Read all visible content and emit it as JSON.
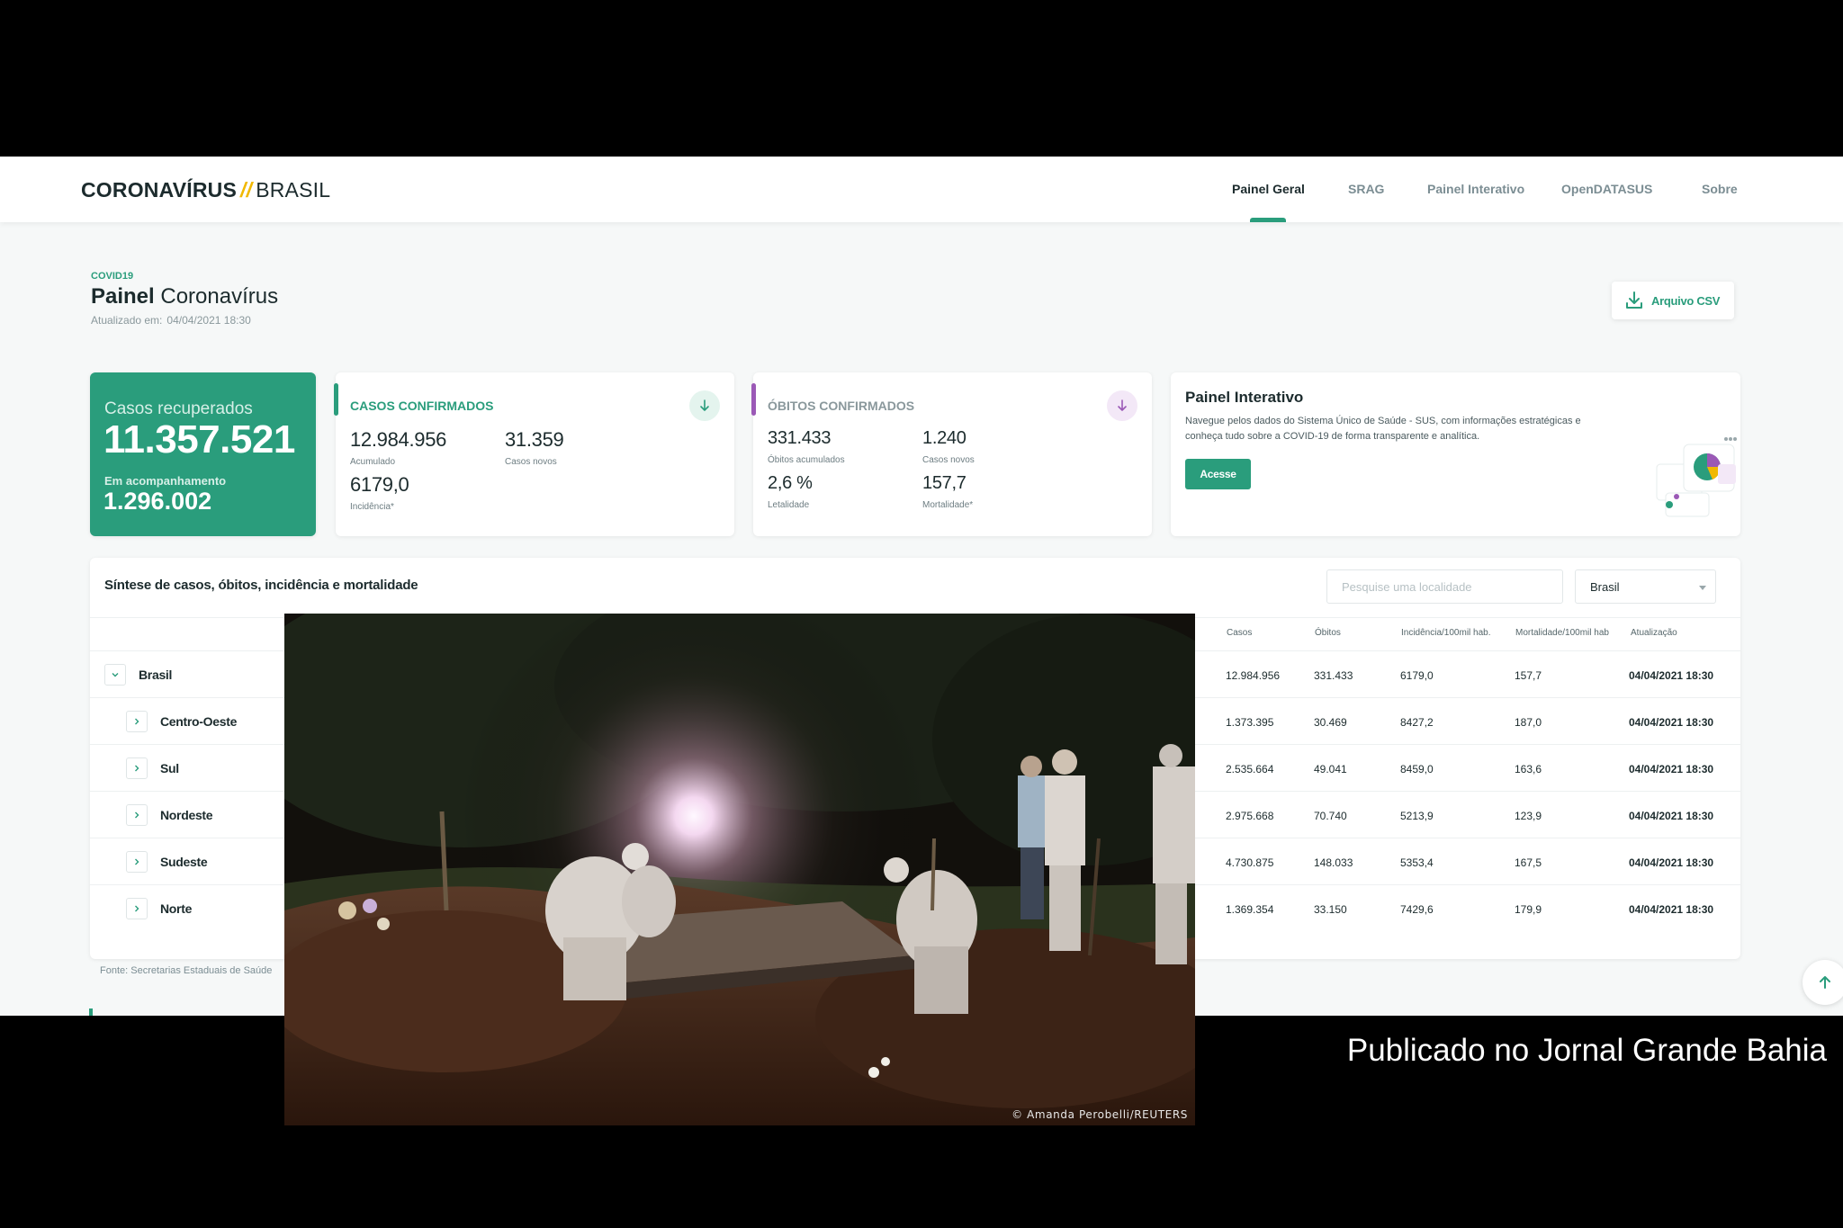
{
  "header": {
    "logo_bold": "CORONAVÍRUS",
    "logo_sep": "//",
    "logo_light": "BRASIL",
    "nav": [
      "Painel Geral",
      "SRAG",
      "Painel Interativo",
      "OpenDATASUS",
      "Sobre"
    ],
    "active_nav": "Painel Geral"
  },
  "page": {
    "eyebrow": "COVID19",
    "title_bold": "Painel",
    "title_light": "Coronavírus",
    "updated_label": "Atualizado em:",
    "updated_value": "04/04/2021 18:30",
    "csv_button": "Arquivo CSV"
  },
  "recovered": {
    "label": "Casos recuperados",
    "value": "11.357.521",
    "monitoring_label": "Em acompanhamento",
    "monitoring_value": "1.296.002"
  },
  "confirmed": {
    "title": "CASOS CONFIRMADOS",
    "accum_value": "12.984.956",
    "accum_label": "Acumulado",
    "new_value": "31.359",
    "new_label": "Casos novos",
    "incid_value": "6179,0",
    "incid_label": "Incidência*"
  },
  "deaths": {
    "title": "ÓBITOS CONFIRMADOS",
    "accum_value": "331.433",
    "accum_label": "Óbitos acumulados",
    "new_value": "1.240",
    "new_label": "Casos novos",
    "lethality_value": "2,6 %",
    "lethality_label": "Letalidade",
    "mortality_value": "157,7",
    "mortality_label": "Mortalidade*"
  },
  "interactive": {
    "title": "Painel Interativo",
    "description": "Navegue pelos dados do Sistema Único de Saúde - SUS, com informações estratégicas e conheça tudo sobre a COVID-19 de forma transparente e analítica.",
    "button": "Acesse"
  },
  "synthesis": {
    "title": "Síntese de casos, óbitos, incidência e mortalidade",
    "search_placeholder": "Pesquise uma localidade",
    "select_value": "Brasil",
    "columns": [
      "Casos",
      "Óbitos",
      "Incidência/100mil hab.",
      "Mortalidade/100mil hab",
      "Atualização"
    ],
    "rows": [
      {
        "name": "Brasil",
        "cases": "12.984.956",
        "deaths": "331.433",
        "incidence": "6179,0",
        "mortality": "157,7",
        "updated": "04/04/2021 18:30"
      },
      {
        "name": "Centro-Oeste",
        "cases": "1.373.395",
        "deaths": "30.469",
        "incidence": "8427,2",
        "mortality": "187,0",
        "updated": "04/04/2021 18:30"
      },
      {
        "name": "Sul",
        "cases": "2.535.664",
        "deaths": "49.041",
        "incidence": "8459,0",
        "mortality": "163,6",
        "updated": "04/04/2021 18:30"
      },
      {
        "name": "Nordeste",
        "cases": "2.975.668",
        "deaths": "70.740",
        "incidence": "5213,9",
        "mortality": "123,9",
        "updated": "04/04/2021 18:30"
      },
      {
        "name": "Sudeste",
        "cases": "4.730.875",
        "deaths": "148.033",
        "incidence": "5353,4",
        "mortality": "167,5",
        "updated": "04/04/2021 18:30"
      },
      {
        "name": "Norte",
        "cases": "1.369.354",
        "deaths": "33.150",
        "incidence": "7429,6",
        "mortality": "179,9",
        "updated": "04/04/2021 18:30"
      }
    ],
    "source": "Fonte: Secretarias Estaduais de Saúde"
  },
  "photo": {
    "credit": "© Amanda Perobelli/REUTERS"
  },
  "caption": "Publicado no Jornal Grande Bahia",
  "colors": {
    "accent": "#2a9d7c",
    "deaths": "#9b59b6",
    "logo_slash": "#f1b800"
  },
  "icons": {
    "csv": "download-icon",
    "confirmed": "arrow-down-icon",
    "deaths": "arrow-down-icon",
    "expand": "chevron-icon",
    "scroll": "arrow-up-icon",
    "illustration": "pie-chart-icon"
  }
}
